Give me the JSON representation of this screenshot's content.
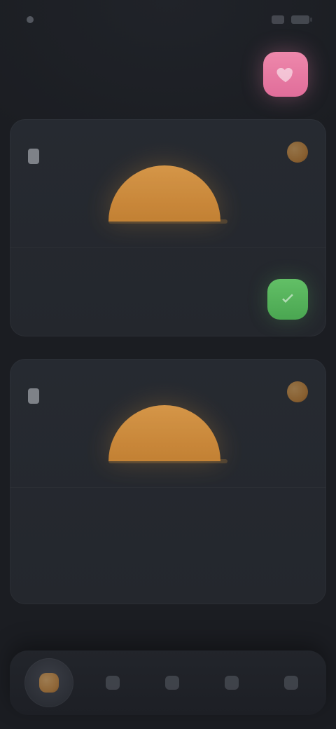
{
  "status": {
    "time": "",
    "icons": [
      "signal-icon",
      "battery-icon"
    ]
  },
  "header": {
    "title": "",
    "heart_icon": "heart-icon"
  },
  "cards": [
    {
      "meta_label": "",
      "meta_icon": "document-icon",
      "badge_icon": "sun-badge-icon",
      "hero_icon": "sunrise-icon",
      "description_lines": [
        "",
        "",
        ""
      ],
      "row_label": "",
      "toggle_icon": "check-icon"
    },
    {
      "meta_label": "",
      "meta_icon": "document-icon",
      "badge_icon": "sun-badge-icon",
      "hero_icon": "sunrise-icon",
      "description_lines": [
        ""
      ],
      "row_label": "",
      "toggle_icon": ""
    }
  ],
  "bottom_nav": {
    "items": [
      {
        "icon": "home-icon",
        "active": true
      },
      {
        "icon": "grid-icon",
        "active": false
      },
      {
        "icon": "search-icon",
        "active": false
      },
      {
        "icon": "stats-icon",
        "active": false
      },
      {
        "icon": "profile-icon",
        "active": false
      }
    ]
  },
  "colors": {
    "orange": "#e29a3a",
    "pink": "#e77fa6",
    "green": "#58b45e"
  }
}
